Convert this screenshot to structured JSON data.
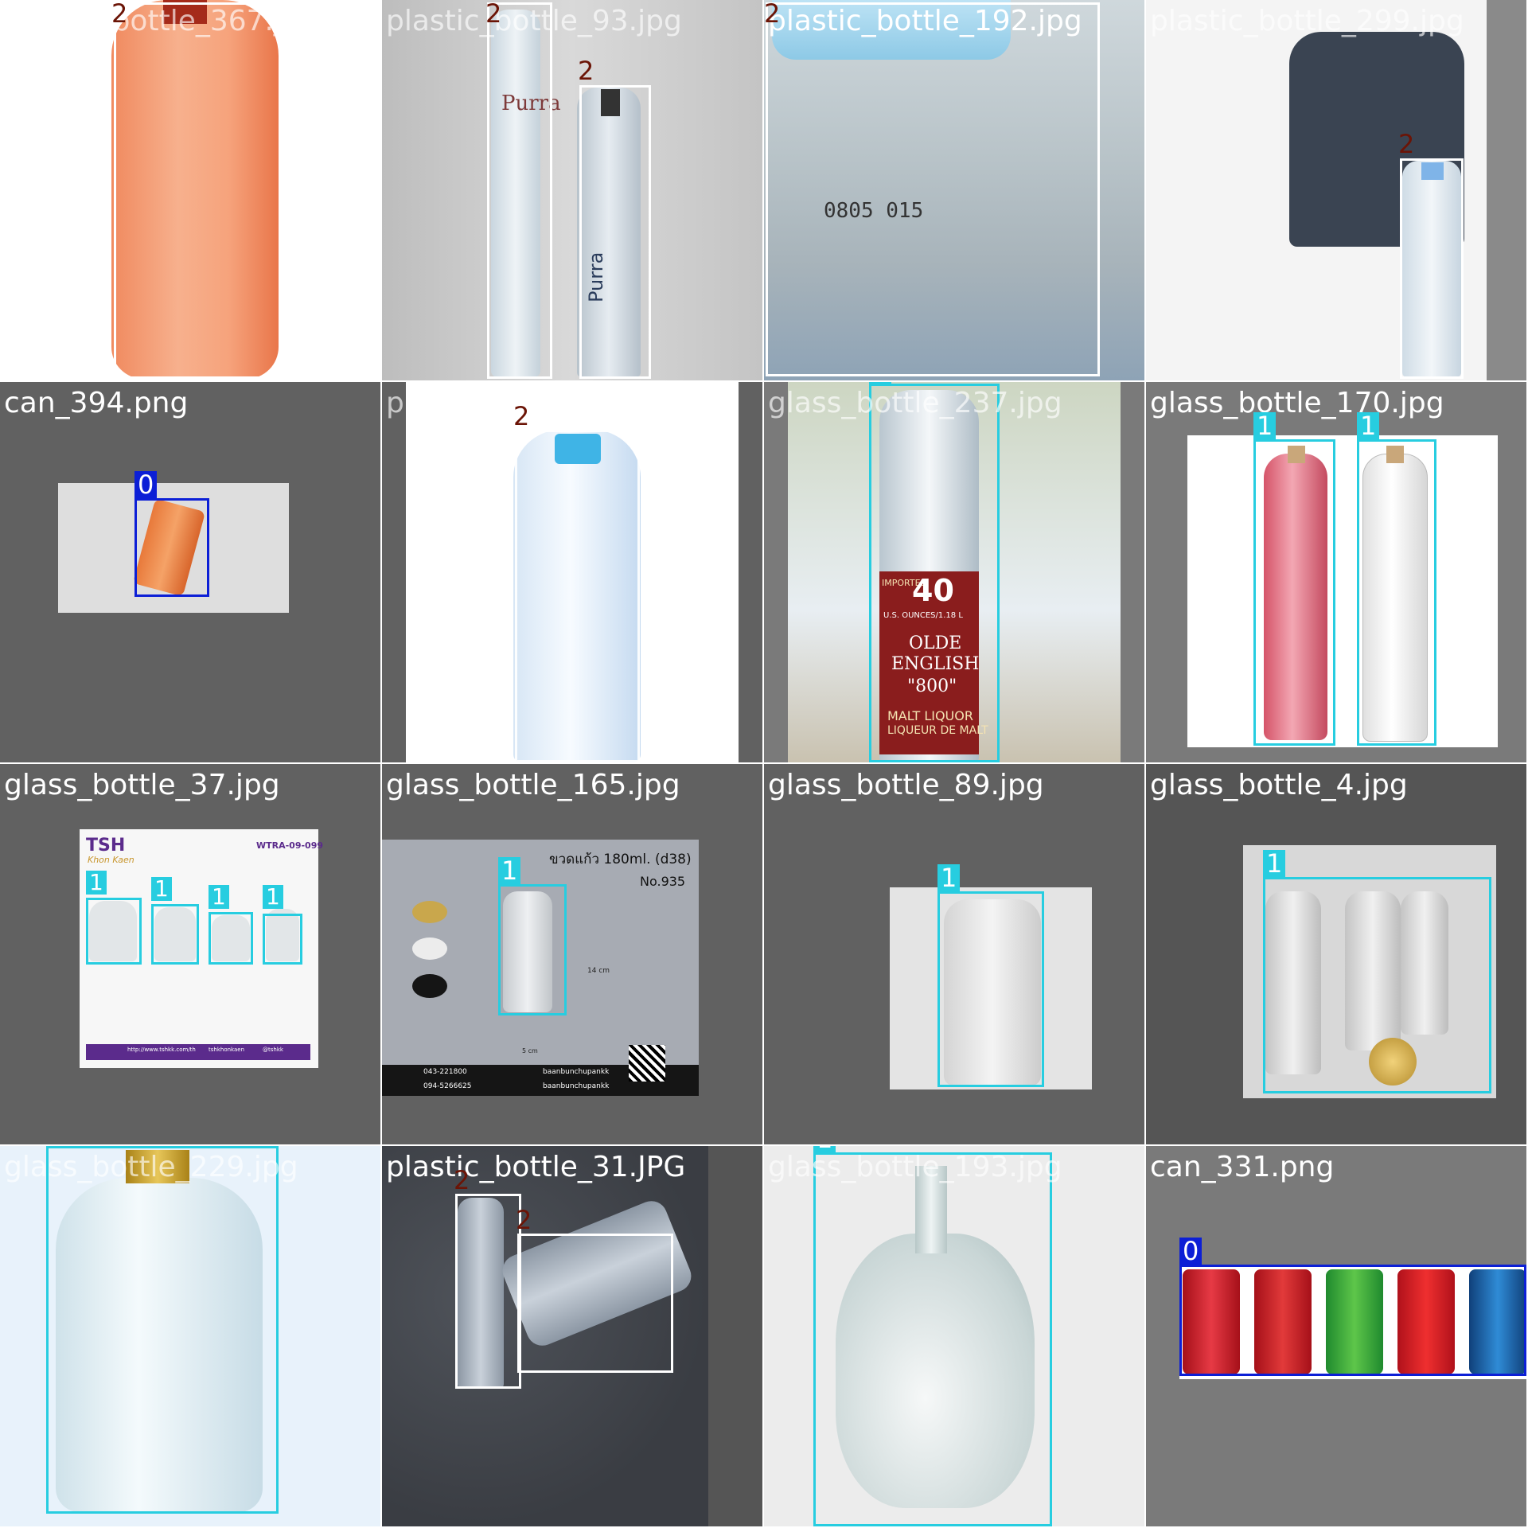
{
  "grid": {
    "tiles": [
      {
        "filename": "plastic_bottle_367.jpg",
        "labels": [
          "2"
        ]
      },
      {
        "filename": "plastic_bottle_93.jpg",
        "labels": [
          "2",
          "2"
        ],
        "bottle_text": [
          "Purra",
          "Purra"
        ]
      },
      {
        "filename": "plastic_bottle_192.jpg",
        "labels": [
          "2"
        ],
        "bottle_text": "0805    015"
      },
      {
        "filename": "plastic_bottle_299.jpg",
        "labels": [
          "2"
        ]
      },
      {
        "filename": "can_394.png",
        "labels": [
          "0"
        ]
      },
      {
        "filename": "plastic_bottle_269.jpg",
        "labels": [
          "2"
        ]
      },
      {
        "filename": "glass_bottle_237.jpg",
        "labels": [
          "1"
        ],
        "label_text": [
          "IMPORTED",
          "40",
          "U.S. OUNCES/1.18 L",
          "OLDE",
          "ENGLISH",
          "\"800\"",
          "MALT LIQUOR",
          "LIQUEUR DE MALT"
        ]
      },
      {
        "filename": "glass_bottle_170.jpg",
        "labels": [
          "1",
          "1"
        ]
      },
      {
        "filename": "glass_bottle_37.jpg",
        "labels": [
          "1",
          "1",
          "1",
          "1"
        ],
        "card_text": [
          "TSH",
          "Khon Kaen",
          "WTRA-09-099",
          "http://www.tshkk.com/th",
          "tshkhonkaen",
          "@tshkk"
        ]
      },
      {
        "filename": "glass_bottle_165.jpg",
        "labels": [
          "1"
        ],
        "card_text": [
          "ขวดแก้ว 180ml. (d38)",
          "No.935",
          "14 cm",
          "5 cm",
          "043-221800",
          "094-5266625",
          "baanbunchupankk",
          "baanbunchupankk"
        ]
      },
      {
        "filename": "glass_bottle_89.jpg",
        "labels": [
          "1"
        ]
      },
      {
        "filename": "glass_bottle_4.jpg",
        "labels": [
          "1"
        ]
      },
      {
        "filename": "glass_bottle_229.jpg",
        "labels": [
          "1"
        ]
      },
      {
        "filename": "plastic_bottle_31.JPG",
        "labels": [
          "2",
          "2"
        ]
      },
      {
        "filename": "glass_bottle_193.jpg",
        "labels": [
          "1"
        ]
      },
      {
        "filename": "can_331.png",
        "labels": [
          "0"
        ]
      }
    ]
  },
  "colors": {
    "class_0": "#0c1fd6",
    "class_1": "#27cde0",
    "class_2": "#ffffff",
    "class_2_label_text": "#6b1406",
    "bg_gray": "#616161",
    "bg_mid": "#7a7a7a"
  }
}
